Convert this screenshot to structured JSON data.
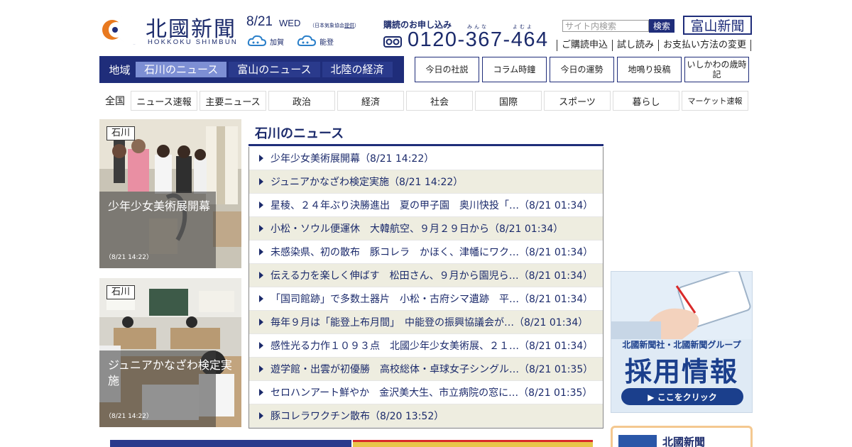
{
  "header": {
    "logo_title": "北國新聞",
    "logo_sub": "HOKKOKU SHIMBUN",
    "date": "8/21",
    "weekday": "WED",
    "weather_note_prefix": "（日本気象協会",
    "weather_note_link": "提供",
    "weather_note_suffix": "）",
    "weather_kaga": "加賀",
    "weather_noto": "能登",
    "subscribe_title": "購読のお申し込み",
    "phone_ruby_1": "みんな",
    "phone_ruby_2": "よむよ",
    "phone": "0120-367-464",
    "search_placeholder": "サイト内検索",
    "search_button": "検索",
    "toyama_logo": "富山新聞",
    "service_links": [
      "ご購読申込",
      "試し読み",
      "お支払い方法の変更"
    ]
  },
  "region_nav": {
    "lead": "地域",
    "tabs": [
      "石川のニュース",
      "富山のニュース",
      "北陸の経済"
    ]
  },
  "feature_buttons": [
    "今日の社説",
    "コラム時鐘",
    "今日の運勢",
    "地鳴り投稿",
    "いしかわの歳時記"
  ],
  "category_nav": {
    "lead": "全国",
    "items": [
      "ニュース速報",
      "主要ニュース",
      "政治",
      "経済",
      "社会",
      "国際",
      "スポーツ",
      "暮らし",
      "マーケット速報"
    ]
  },
  "photos": [
    {
      "tag": "石川",
      "caption": "少年少女美術展開幕",
      "time": "（8/21 14:22）"
    },
    {
      "tag": "石川",
      "caption": "ジュニアかなざわ検定実施",
      "time": "（8/21 14:22）"
    }
  ],
  "news": {
    "title": "石川のニュース",
    "items": [
      "少年少女美術展開幕（8/21 14:22）",
      "ジュニアかなざわ検定実施（8/21 14:22）",
      "星稜、２４年ぶり決勝進出　夏の甲子園　奥川快投「…（8/21 01:34）",
      "小松・ソウル便運休　大韓航空、９月２９日から（8/21 01:34）",
      "未感染県、初の散布　豚コレラ　かほく、津幡にワク…（8/21 01:34）",
      "伝える力を楽しく伸ばす　松田さん、９月から園児ら…（8/21 01:34）",
      "「国司館跡」で多数土器片　小松・古府シマ遺跡　平…（8/21 01:34）",
      "毎年９月は「能登上布月間」　中能登の振興協議会が…（8/21 01:34）",
      "感性光る力作１０９３点　北國少年少女美術展、２１…（8/21 01:34）",
      "遊学館・出雲が初優勝　高校総体・卓球女子シングル…（8/21 01:35）",
      "セロハンアート鮮やか　金沢美大生、市立病院の窓に…（8/21 01:35）",
      "豚コレラワクチン散布（8/20 13:52）"
    ]
  },
  "banner": {
    "line1": "北國新聞社・北國新聞グループ",
    "line2": "採用情報",
    "button": "▶ ここをクリック"
  },
  "card2": {
    "name": "北國新聞"
  },
  "colors": {
    "brand_navy": "#1f2d7a",
    "accent_light": "#7d8fd4",
    "row_alt": "#eeede0"
  }
}
